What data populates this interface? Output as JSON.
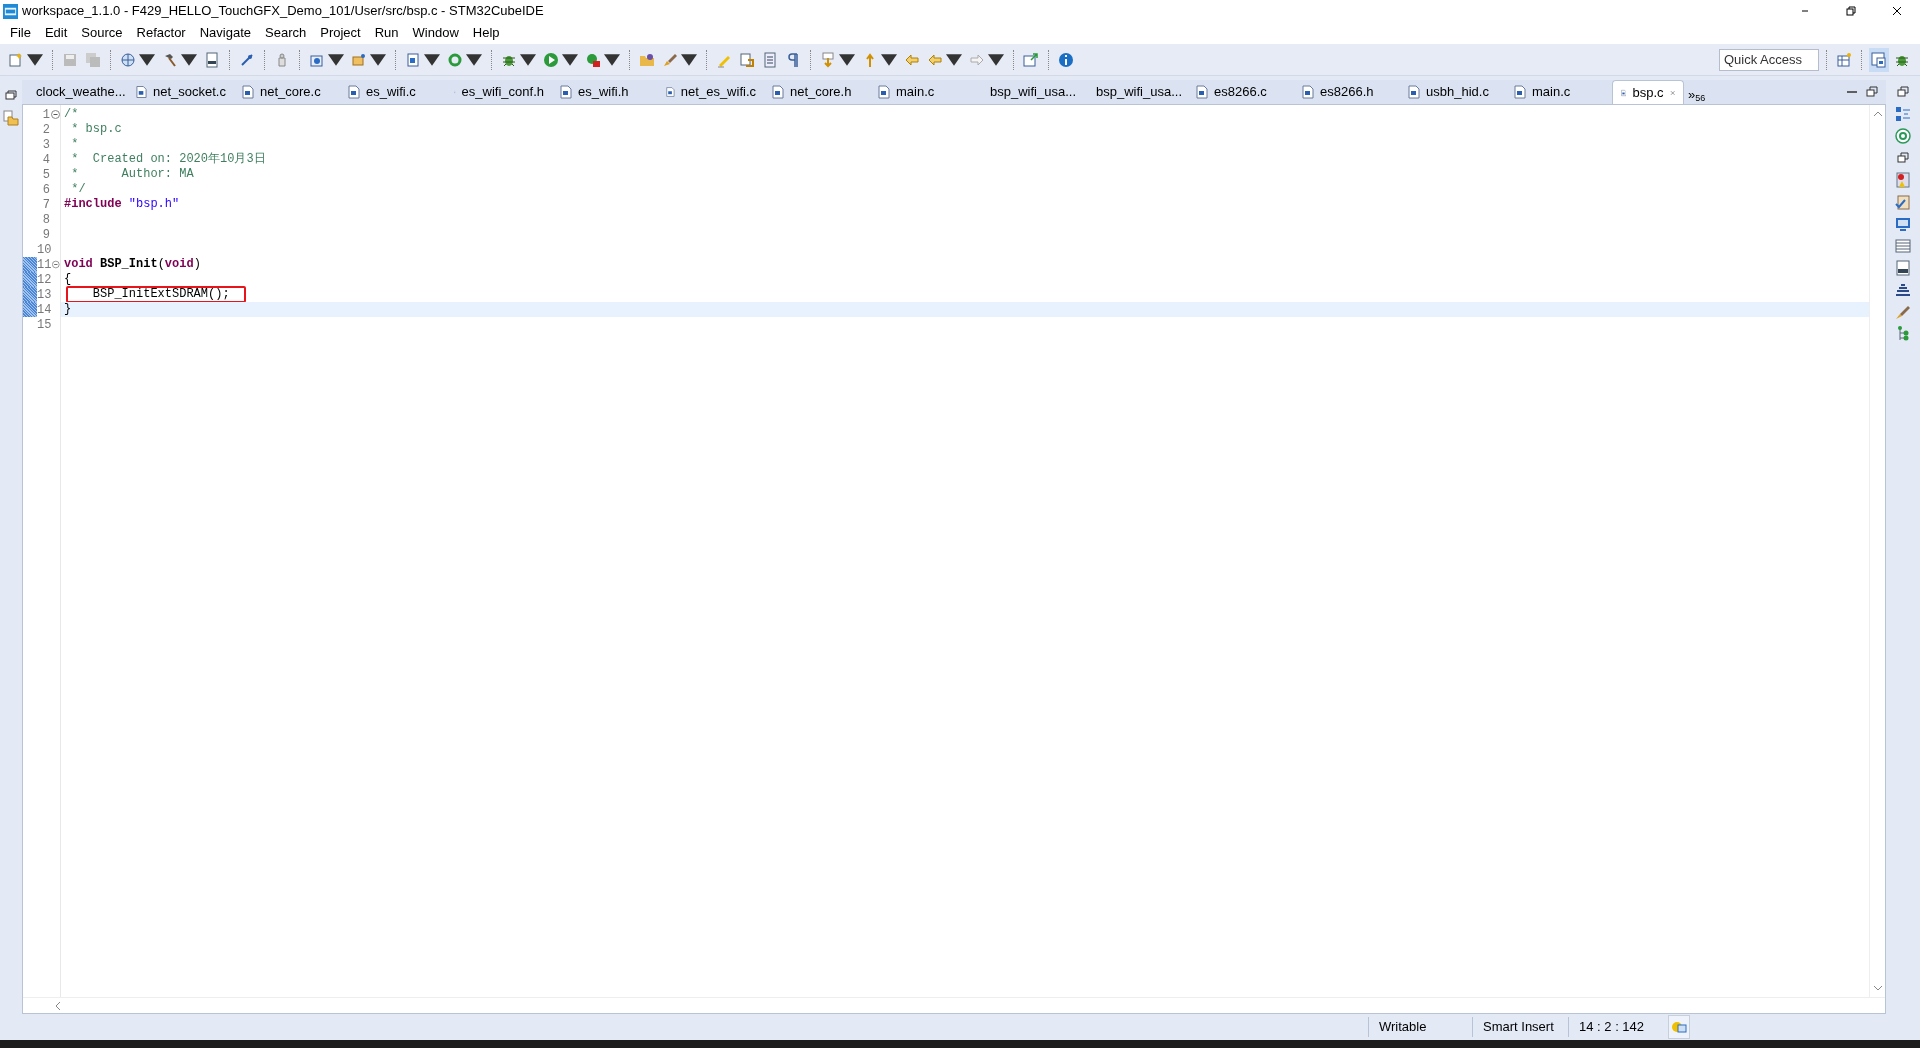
{
  "window": {
    "title": "workspace_1.1.0 - F429_HELLO_TouchGFX_Demo_101/User/src/bsp.c - STM32CubeIDE"
  },
  "menu": [
    "File",
    "Edit",
    "Source",
    "Refactor",
    "Navigate",
    "Search",
    "Project",
    "Run",
    "Window",
    "Help"
  ],
  "quick_access": {
    "placeholder": "Quick Access"
  },
  "tabs": [
    {
      "label": "clock_weathe...",
      "selected": false
    },
    {
      "label": "net_socket.c",
      "selected": false
    },
    {
      "label": "net_core.c",
      "selected": false
    },
    {
      "label": "es_wifi.c",
      "selected": false
    },
    {
      "label": "es_wifi_conf.h",
      "selected": false
    },
    {
      "label": "es_wifi.h",
      "selected": false
    },
    {
      "label": "net_es_wifi.c",
      "selected": false
    },
    {
      "label": "net_core.h",
      "selected": false
    },
    {
      "label": "main.c",
      "selected": false
    },
    {
      "label": "bsp_wifi_usa...",
      "selected": false
    },
    {
      "label": "bsp_wifi_usa...",
      "selected": false
    },
    {
      "label": "es8266.c",
      "selected": false
    },
    {
      "label": "es8266.h",
      "selected": false
    },
    {
      "label": "usbh_hid.c",
      "selected": false
    },
    {
      "label": "main.c",
      "selected": false
    },
    {
      "label": "bsp.c",
      "selected": true
    }
  ],
  "tabs_overflow": {
    "chevron": "»",
    "count": "56"
  },
  "editor": {
    "lines": [
      {
        "number": "1",
        "fold": true,
        "changed": false,
        "current": false,
        "boxed": false,
        "tokens": [
          {
            "kind": "comment",
            "text": "/*"
          }
        ]
      },
      {
        "number": "2",
        "fold": false,
        "changed": false,
        "current": false,
        "boxed": false,
        "tokens": [
          {
            "kind": "comment",
            "text": " * bsp.c"
          }
        ]
      },
      {
        "number": "3",
        "fold": false,
        "changed": false,
        "current": false,
        "boxed": false,
        "tokens": [
          {
            "kind": "comment",
            "text": " *"
          }
        ]
      },
      {
        "number": "4",
        "fold": false,
        "changed": false,
        "current": false,
        "boxed": false,
        "tokens": [
          {
            "kind": "comment",
            "text": " *  Created on: 2020年10月3日"
          }
        ]
      },
      {
        "number": "5",
        "fold": false,
        "changed": false,
        "current": false,
        "boxed": false,
        "tokens": [
          {
            "kind": "comment",
            "text": " *      Author: MA"
          }
        ]
      },
      {
        "number": "6",
        "fold": false,
        "changed": false,
        "current": false,
        "boxed": false,
        "tokens": [
          {
            "kind": "comment",
            "text": " */"
          }
        ]
      },
      {
        "number": "7",
        "fold": false,
        "changed": false,
        "current": false,
        "boxed": false,
        "tokens": [
          {
            "kind": "directive",
            "text": "#include"
          },
          {
            "kind": "string",
            "text": "\"bsp.h\""
          }
        ]
      },
      {
        "number": "8",
        "fold": false,
        "changed": false,
        "current": false,
        "boxed": false
      },
      {
        "number": "9",
        "fold": false,
        "changed": false,
        "current": false,
        "boxed": false
      },
      {
        "number": "10",
        "fold": false,
        "changed": false,
        "current": false,
        "boxed": false
      },
      {
        "number": "11",
        "fold": true,
        "changed": true,
        "current": false,
        "boxed": false,
        "tokens": [
          {
            "kind": "keyword",
            "text": "void"
          },
          {
            "kind": "function",
            "text": "BSP_Init"
          },
          {
            "kind": "plain",
            "text": "("
          },
          {
            "kind": "keyword",
            "text": "void"
          },
          {
            "kind": "plain",
            "text": ")"
          }
        ]
      },
      {
        "number": "12",
        "fold": false,
        "changed": true,
        "current": false,
        "boxed": false,
        "tokens": [
          {
            "kind": "plain",
            "text": "{"
          }
        ]
      },
      {
        "number": "13",
        "fold": false,
        "changed": true,
        "current": false,
        "boxed": true,
        "tokens": [
          {
            "kind": "plain",
            "text": "    BSP_InitExtSDRAM();"
          }
        ]
      },
      {
        "number": "14",
        "fold": false,
        "changed": true,
        "current": true,
        "boxed": false,
        "tokens": [
          {
            "kind": "plain",
            "text": "}"
          }
        ]
      },
      {
        "number": "15",
        "fold": false,
        "changed": false,
        "current": false,
        "boxed": false
      }
    ]
  },
  "status_bar": [
    "Writable",
    "Smart Insert",
    "14 : 2 : 142"
  ]
}
